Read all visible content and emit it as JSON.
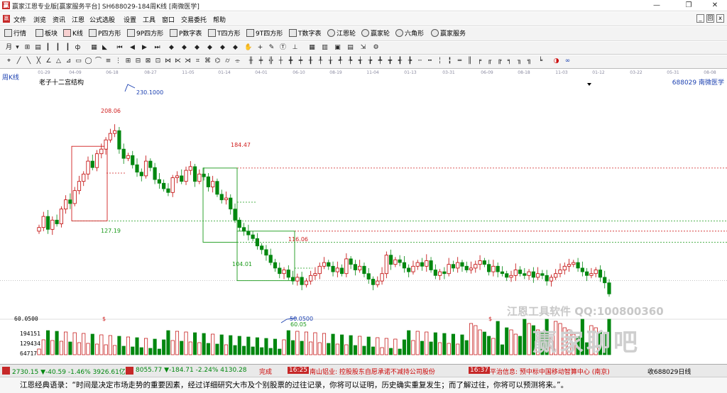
{
  "window": {
    "title": "赢家江恩专业版[赢家服务平台]  SH688029-184周K线  [南微医学]"
  },
  "menu": {
    "items": [
      "文件",
      "浏览",
      "资讯",
      "江恩",
      "公式选股",
      "设置",
      "工具",
      "窗口",
      "交易委托",
      "帮助"
    ],
    "sys": [
      "_",
      "回",
      "x"
    ]
  },
  "toolbar1": {
    "items": [
      "行情",
      "板块",
      "K线",
      "P四方形",
      "9P四方形",
      "P数字表",
      "T四方形",
      "9T四方形",
      "T数字表",
      "江恩轮",
      "赢家轮",
      "六角形",
      "赢家服务"
    ]
  },
  "chart": {
    "period_label": "周K线",
    "study_name": "老子十二宫结构",
    "stock_id": "688029  南微医学",
    "date_ticks": [
      "01-29",
      "04-09",
      "06-18",
      "08-27",
      "11-05",
      "01-14",
      "04-01",
      "06-10",
      "08-19",
      "11-04",
      "01-13",
      "03-31",
      "06-09",
      "08-18",
      "11-03",
      "01-12",
      "03-22",
      "05-31",
      "08-08"
    ],
    "price_labels": [
      "230.1000",
      "208.06",
      "127.19",
      "184.47",
      "116.06",
      "104.01",
      "50.0500",
      "60.05"
    ],
    "volume_labels": [
      "194151",
      "129434",
      "64717"
    ],
    "low_label": "60.0500",
    "marker": "$",
    "watermark_small": "江恩工具软件  QQ:100800360",
    "watermark_big": "赢家聊吧",
    "colors": {
      "up": "#c00000",
      "down": "#00870f",
      "line_red": "#d02020",
      "line_green": "#1a9a1a",
      "fib": "#1a3fb0"
    }
  },
  "status": {
    "sh": "2730.15 ▼-40.59 -1.46% 3926.61亿",
    "sz": "8055.77 ▼-184.71 -2.24% 4130.28",
    "feed1": "完成",
    "t1": "16:25",
    "news1": "南山铝业: 控股股东自愿承诺不减持公司股份",
    "t2": "16:37",
    "news2": "平治信息: 预中标中国移动智算中心 (南京)",
    "tail": "收688029日线"
  },
  "quote": "江恩经典语录：“时间是决定市场走势的重要因素，经过详细研究大市及个别股票的过往记录，你将可以证明，历史确实重复发生；而了解过往，你将可以预测将来。”。"
}
